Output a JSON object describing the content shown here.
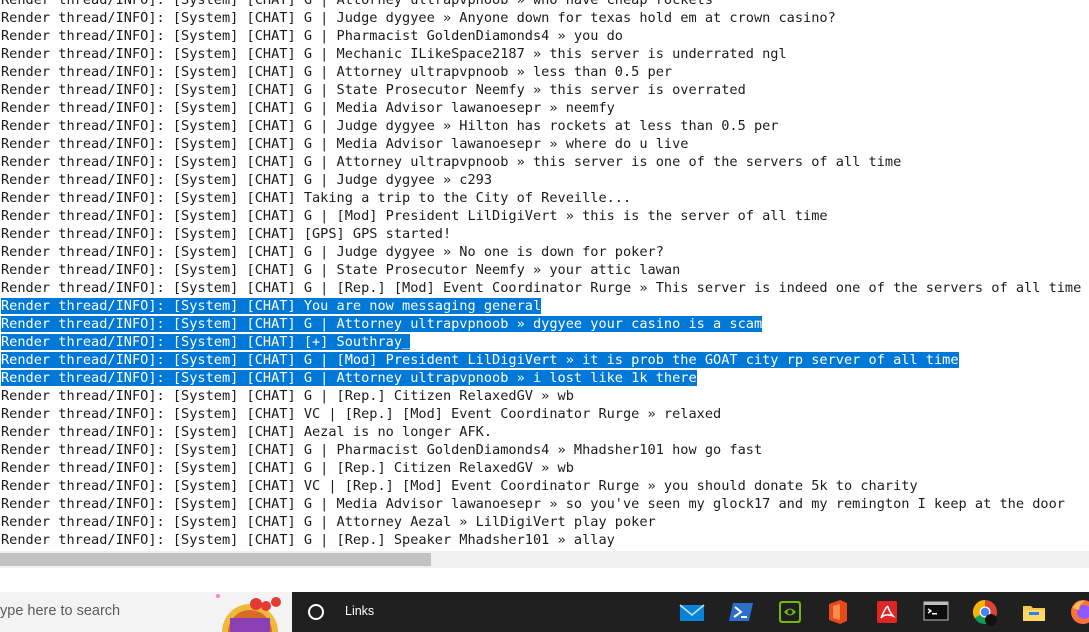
{
  "console": {
    "lines": [
      {
        "text": "Render thread/INFO]: [System] [CHAT] G | Attorney ultrapvpnoob » who have cheap rockets",
        "selected": false
      },
      {
        "text": "Render thread/INFO]: [System] [CHAT] G | Judge dygyee » Anyone down for texas hold em at crown casino?",
        "selected": false
      },
      {
        "text": "Render thread/INFO]: [System] [CHAT] G | Pharmacist GoldenDiamonds4 » you do",
        "selected": false
      },
      {
        "text": "Render thread/INFO]: [System] [CHAT] G | Mechanic ILikeSpace2187 » this server is underrated ngl",
        "selected": false
      },
      {
        "text": "Render thread/INFO]: [System] [CHAT] G | Attorney ultrapvpnoob » less than 0.5 per",
        "selected": false
      },
      {
        "text": "Render thread/INFO]: [System] [CHAT] G | State Prosecutor Neemfy » this server is overrated",
        "selected": false
      },
      {
        "text": "Render thread/INFO]: [System] [CHAT] G | Media Advisor lawanoesepr » neemfy",
        "selected": false
      },
      {
        "text": "Render thread/INFO]: [System] [CHAT] G | Judge dygyee » Hilton has rockets at less than 0.5 per",
        "selected": false
      },
      {
        "text": "Render thread/INFO]: [System] [CHAT] G | Media Advisor lawanoesepr » where do u live",
        "selected": false
      },
      {
        "text": "Render thread/INFO]: [System] [CHAT] G | Attorney ultrapvpnoob » this server is one of the servers of all time",
        "selected": false
      },
      {
        "text": "Render thread/INFO]: [System] [CHAT] G | Judge dygyee » c293",
        "selected": false
      },
      {
        "text": "Render thread/INFO]: [System] [CHAT] Taking a trip to the City of Reveille...",
        "selected": false
      },
      {
        "text": "Render thread/INFO]: [System] [CHAT] G | [Mod] President LilDigiVert » this is the server of all time",
        "selected": false
      },
      {
        "text": "Render thread/INFO]: [System] [CHAT] [GPS] GPS started!",
        "selected": false
      },
      {
        "text": "Render thread/INFO]: [System] [CHAT] G | Judge dygyee » No one is down for poker?",
        "selected": false
      },
      {
        "text": "Render thread/INFO]: [System] [CHAT] G | State Prosecutor Neemfy » your attic lawan",
        "selected": false
      },
      {
        "text": "Render thread/INFO]: [System] [CHAT] G | [Rep.] [Mod] Event Coordinator Rurge » This server is indeed one of the servers of all time",
        "selected": false
      },
      {
        "text": "Render thread/INFO]: [System] [CHAT] You are now messaging general",
        "selected": true
      },
      {
        "text": "Render thread/INFO]: [System] [CHAT] G | Attorney ultrapvpnoob » dygyee your casino is a scam",
        "selected": true
      },
      {
        "text": "Render thread/INFO]: [System] [CHAT] [+] Southray_",
        "selected": true
      },
      {
        "text": "Render thread/INFO]: [System] [CHAT] G | [Mod] President LilDigiVert » it is prob the GOAT city rp server of all time",
        "selected": true
      },
      {
        "text": "Render thread/INFO]: [System] [CHAT] G | Attorney ultrapvpnoob » i lost like 1k there",
        "selected": true
      },
      {
        "text": "Render thread/INFO]: [System] [CHAT] G | [Rep.] Citizen RelaxedGV » wb",
        "selected": false
      },
      {
        "text": "Render thread/INFO]: [System] [CHAT] VC | [Rep.] [Mod] Event Coordinator Rurge » relaxed",
        "selected": false
      },
      {
        "text": "Render thread/INFO]: [System] [CHAT] Aezal is no longer AFK.",
        "selected": false
      },
      {
        "text": "Render thread/INFO]: [System] [CHAT] G | Pharmacist GoldenDiamonds4 » Mhadsher101 how go fast",
        "selected": false
      },
      {
        "text": "Render thread/INFO]: [System] [CHAT] G | [Rep.] Citizen RelaxedGV » wb",
        "selected": false
      },
      {
        "text": "Render thread/INFO]: [System] [CHAT] VC | [Rep.] [Mod] Event Coordinator Rurge » you should donate 5k to charity",
        "selected": false
      },
      {
        "text": "Render thread/INFO]: [System] [CHAT] G | Media Advisor lawanoesepr » so you've seen my glock17 and my remington I keep at the door",
        "selected": false
      },
      {
        "text": "Render thread/INFO]: [System] [CHAT] G | Attorney Aezal » LilDigiVert play poker",
        "selected": false
      },
      {
        "text": "Render thread/INFO]: [System] [CHAT] G | [Rep.] Speaker Mhadsher101 » allay",
        "selected": false
      }
    ],
    "selection_color": "#0078d7"
  },
  "taskbar": {
    "search_placeholder": "ype here to search",
    "links_label": "Links",
    "apps": [
      {
        "icon": "mail-icon"
      },
      {
        "icon": "powershell-icon"
      },
      {
        "icon": "nvidia-icon"
      },
      {
        "icon": "office-icon"
      },
      {
        "icon": "pdf-icon"
      },
      {
        "icon": "terminal-icon"
      },
      {
        "icon": "chrome-icon"
      },
      {
        "icon": "file-explorer-icon"
      },
      {
        "icon": "firefox-icon"
      }
    ]
  }
}
